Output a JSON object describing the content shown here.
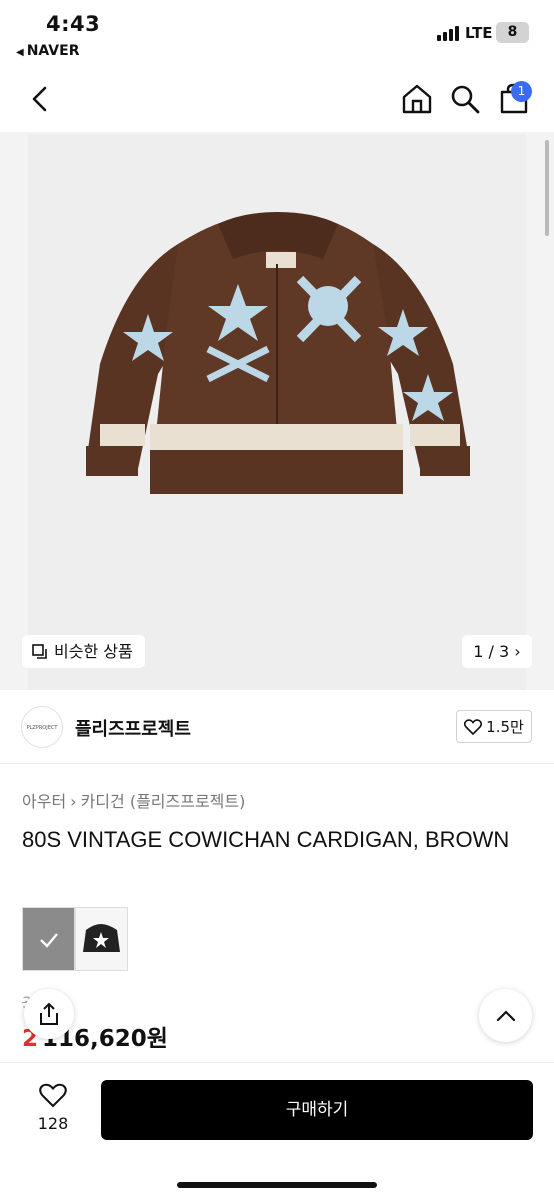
{
  "status": {
    "time": "4:43",
    "back_app": "NAVER",
    "network": "LTE",
    "battery": "8"
  },
  "nav": {
    "cart_badge": "1"
  },
  "gallery": {
    "similar_label": "비슷한 상품",
    "pager": "1 / 3"
  },
  "store": {
    "logo_text": "PLZPROJECT",
    "name": "플리즈프로젝트",
    "likes": "1.5만"
  },
  "breadcrumb": {
    "level1": "아우터",
    "level2": "카디건 (플리즈프로젝트)"
  },
  "product": {
    "title": "80S VINTAGE COWICHAN CARDIGAN, BROWN",
    "original_price": "3",
    "discount": "2",
    "sale_price": "116,620원"
  },
  "bottom": {
    "wish_count": "128",
    "buy_label": "구매하기"
  },
  "colors": {
    "badge": "#3a6cf0",
    "discount": "#e32c2c",
    "buy_button": "#000000",
    "cardigan_brown": "#5a3423",
    "cardigan_pattern": "#bcd8e6"
  },
  "icons": [
    "back-arrow-icon",
    "home-icon",
    "search-icon",
    "cart-icon",
    "similar-icon",
    "chevron-right-icon",
    "heart-icon",
    "share-icon",
    "chevron-up-icon",
    "check-icon"
  ]
}
